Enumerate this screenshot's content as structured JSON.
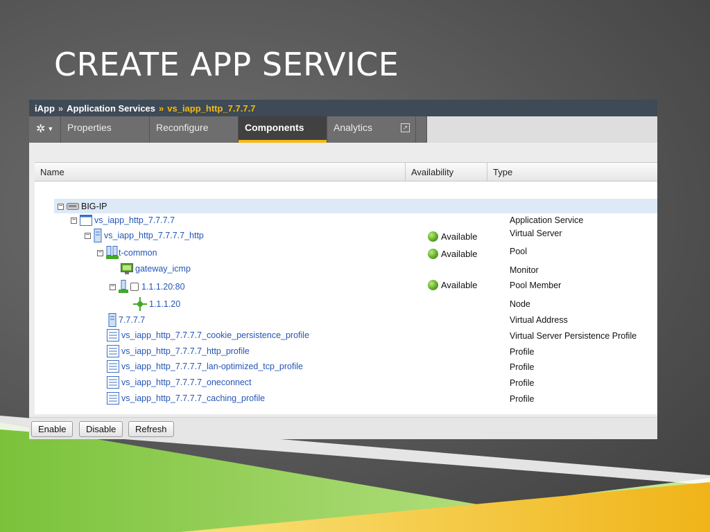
{
  "slide": {
    "title": "CREATE APP SERVICE"
  },
  "breadcrumb": {
    "root": "iApp",
    "section": "Application Services",
    "current": "vs_iapp_http_7.7.7.7",
    "sep": "»"
  },
  "tabs": [
    "Properties",
    "Reconfigure",
    "Components",
    "Analytics"
  ],
  "active_tab": "Components",
  "table": {
    "headers": {
      "name": "Name",
      "availability": "Availability",
      "type": "Type"
    },
    "rows": [
      {
        "name": "BIG-IP",
        "type": ""
      },
      {
        "name": "vs_iapp_http_7.7.7.7",
        "type": "Application Service"
      },
      {
        "name": "vs_iapp_http_7.7.7.7_http",
        "availability": "Available",
        "type": "Virtual Server"
      },
      {
        "name": "t-common",
        "availability": "Available",
        "type": "Pool"
      },
      {
        "name": "gateway_icmp",
        "type": "Monitor"
      },
      {
        "name": "1.1.1.20:80",
        "availability": "Available",
        "type": "Pool Member"
      },
      {
        "name": "1.1.1.20",
        "type": "Node"
      },
      {
        "name": "7.7.7.7",
        "type": "Virtual Address"
      },
      {
        "name": "vs_iapp_http_7.7.7.7_cookie_persistence_profile",
        "type": "Virtual Server Persistence Profile"
      },
      {
        "name": "vs_iapp_http_7.7.7.7_http_profile",
        "type": "Profile"
      },
      {
        "name": "vs_iapp_http_7.7.7.7_lan-optimized_tcp_profile",
        "type": "Profile"
      },
      {
        "name": "vs_iapp_http_7.7.7.7_oneconnect",
        "type": "Profile"
      },
      {
        "name": "vs_iapp_http_7.7.7.7_caching_profile",
        "type": "Profile"
      }
    ]
  },
  "buttons": {
    "enable": "Enable",
    "disable": "Disable",
    "refresh": "Refresh"
  },
  "colors": {
    "accent": "#f6b910",
    "link": "#2455b5",
    "header_bar": "#3e4a56",
    "status_available": "#5aa51f"
  }
}
